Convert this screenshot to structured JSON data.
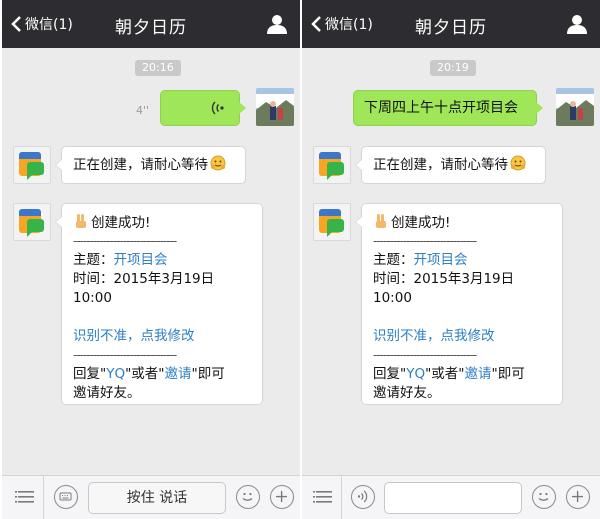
{
  "panels": [
    {
      "header": {
        "back_label": "微信(1)",
        "title": "朝夕日历"
      },
      "timestamp": "20:16",
      "user_message": {
        "type": "voice",
        "duration": "4''"
      },
      "bot_reply_1": {
        "text": "正在创建，请耐心等待"
      },
      "bot_reply_2": {
        "heading": "创建成功!",
        "separator": "-------------------------------",
        "topic_label": "主题：",
        "topic_value": "开项目会",
        "time_label": "时间：",
        "time_value": "2015年3月19日",
        "time_value_2": "10:00",
        "fix_link": "识别不准，点我修改",
        "reply_prefix": "回复\"",
        "reply_kw1": "YQ",
        "reply_mid": "\"或者\"",
        "reply_kw2": "邀请",
        "reply_suffix": "\"即可",
        "reply_line2": "邀请好友。"
      },
      "bottom_bar": {
        "mode": "voice",
        "hold_label": "按住 说话"
      }
    },
    {
      "header": {
        "back_label": "微信(1)",
        "title": "朝夕日历"
      },
      "timestamp": "20:19",
      "user_message": {
        "type": "text",
        "text": "下周四上午十点开项目会"
      },
      "bot_reply_1": {
        "text": "正在创建，请耐心等待"
      },
      "bot_reply_2": {
        "heading": "创建成功!",
        "separator": "-------------------------------",
        "topic_label": "主题：",
        "topic_value": "开项目会",
        "time_label": "时间：",
        "time_value": "2015年3月19日",
        "time_value_2": "10:00",
        "fix_link": "识别不准，点我修改",
        "reply_prefix": "回复\"",
        "reply_kw1": "YQ",
        "reply_mid": "\"或者\"",
        "reply_kw2": "邀请",
        "reply_suffix": "\"即可",
        "reply_line2": "邀请好友。"
      },
      "bottom_bar": {
        "mode": "text",
        "input_value": ""
      }
    }
  ],
  "colors": {
    "header_bg": "#2c2c31",
    "chat_bg": "#ebebeb",
    "bubble_green": "#9fe658",
    "link": "#2d7fc8",
    "timestamp_pill": "#c9c9c9"
  },
  "icons": [
    "chevron-left-icon",
    "person-icon",
    "voice-wave-icon",
    "calendar-app-icon",
    "hugging-emoji-icon",
    "victory-hand-emoji-icon",
    "menu-list-icon",
    "keyboard-icon",
    "emoji-icon",
    "plus-icon"
  ]
}
